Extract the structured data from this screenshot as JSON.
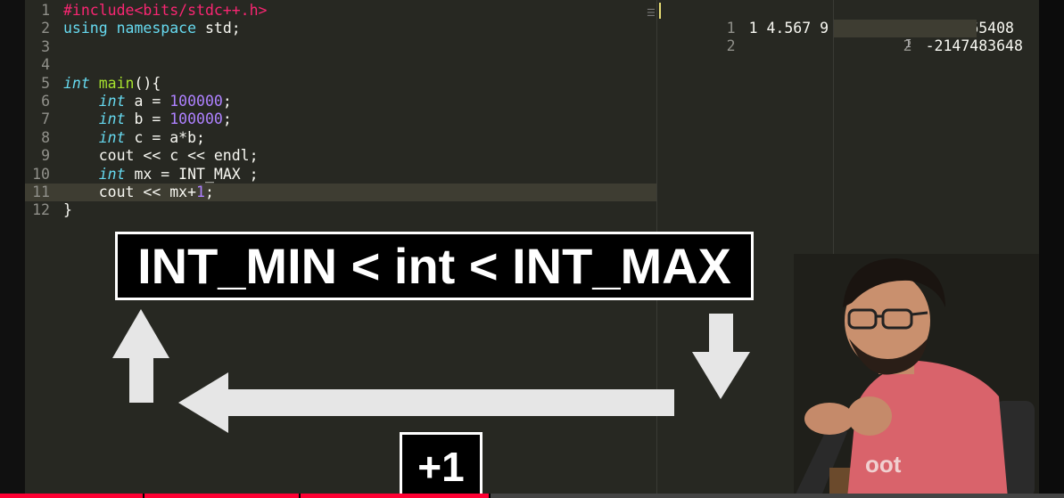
{
  "editor": {
    "lines": [
      {
        "n": "1",
        "parts": [
          [
            "kw-pre",
            "#include<bits/stdc++.h>"
          ]
        ]
      },
      {
        "n": "2",
        "parts": [
          [
            "kw-use",
            "using namespace"
          ],
          [
            "plain",
            " std;"
          ]
        ]
      },
      {
        "n": "3",
        "parts": []
      },
      {
        "n": "4",
        "parts": []
      },
      {
        "n": "5",
        "parts": [
          [
            "kw-type",
            "int"
          ],
          [
            "plain",
            " "
          ],
          [
            "kw-fn",
            "main"
          ],
          [
            "plain",
            "(){"
          ]
        ]
      },
      {
        "n": "6",
        "parts": [
          [
            "plain",
            "    "
          ],
          [
            "kw-type",
            "int"
          ],
          [
            "plain",
            " a = "
          ],
          [
            "num",
            "100000"
          ],
          [
            "plain",
            ";"
          ]
        ]
      },
      {
        "n": "7",
        "parts": [
          [
            "plain",
            "    "
          ],
          [
            "kw-type",
            "int"
          ],
          [
            "plain",
            " b = "
          ],
          [
            "num",
            "100000"
          ],
          [
            "plain",
            ";"
          ]
        ]
      },
      {
        "n": "8",
        "parts": [
          [
            "plain",
            "    "
          ],
          [
            "kw-type",
            "int"
          ],
          [
            "plain",
            " c = a*b;"
          ]
        ]
      },
      {
        "n": "9",
        "parts": [
          [
            "plain",
            "    cout << c << endl;"
          ]
        ]
      },
      {
        "n": "10",
        "parts": [
          [
            "plain",
            "    "
          ],
          [
            "kw-type",
            "int"
          ],
          [
            "plain",
            " mx = INT_MAX ;"
          ]
        ]
      },
      {
        "n": "11",
        "parts": [
          [
            "plain",
            "    cout << mx+"
          ],
          [
            "num",
            "1"
          ],
          [
            "plain",
            ";"
          ]
        ]
      },
      {
        "n": "12",
        "parts": [
          [
            "plain",
            "}"
          ]
        ]
      }
    ]
  },
  "input": {
    "lines": [
      {
        "n": "1",
        "text": "1 4.567 9"
      },
      {
        "n": "2",
        "text": ""
      }
    ]
  },
  "output": {
    "lines": [
      {
        "n": "1",
        "text": "1410065408"
      },
      {
        "n": "2",
        "text": "-2147483648"
      }
    ]
  },
  "overlay": {
    "headline": "INT_MIN < int < INT_MAX",
    "plus_one": "+1"
  },
  "video": {
    "progress": 0.46
  },
  "colors": {
    "progress": "#ff0033",
    "background": "#272822"
  }
}
